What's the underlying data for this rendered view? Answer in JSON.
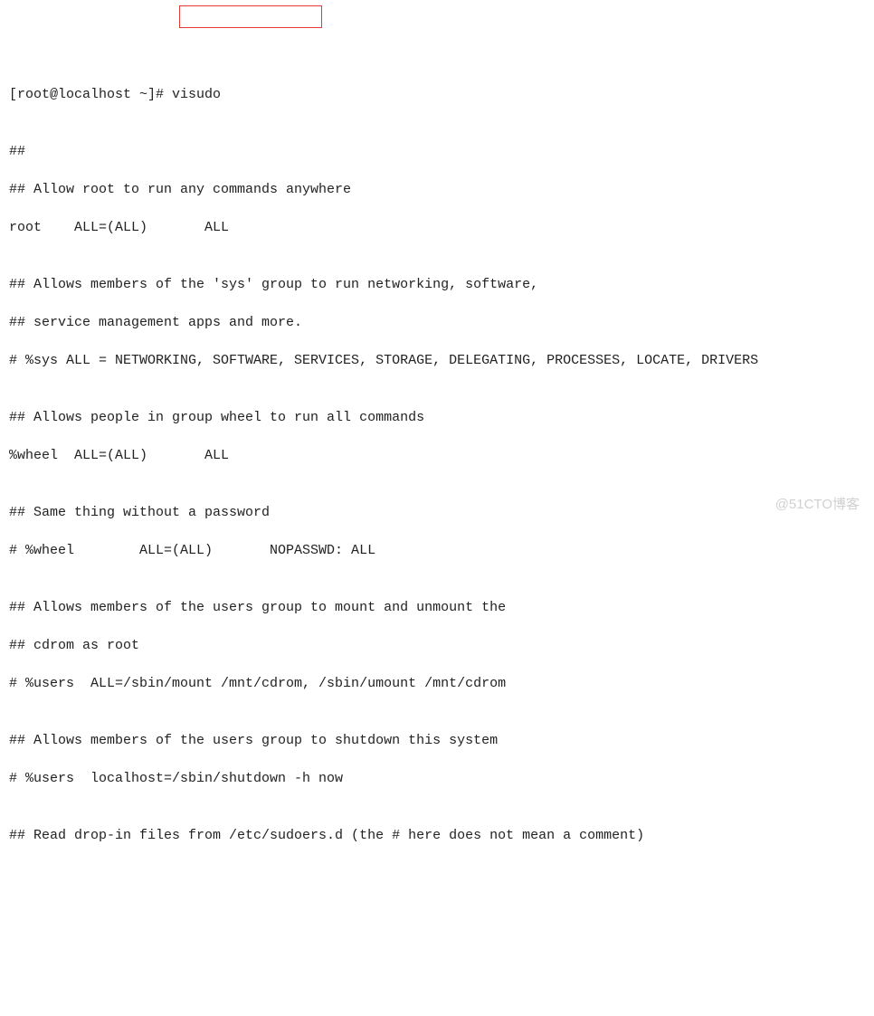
{
  "prompt": {
    "user_host": "[root@localhost ~]# ",
    "command": "visudo"
  },
  "lines": {
    "l0": "",
    "l1": "##",
    "l2": "## Allow root to run any commands anywhere",
    "l3": "root    ALL=(ALL)       ALL",
    "l4": "",
    "l5": "## Allows members of the 'sys' group to run networking, software,",
    "l6": "## service management apps and more.",
    "l7": "# %sys ALL = NETWORKING, SOFTWARE, SERVICES, STORAGE, DELEGATING, PROCESSES, LOCATE, DRIVERS",
    "l8": "",
    "l9": "## Allows people in group wheel to run all commands",
    "l10": "%wheel  ALL=(ALL)       ALL",
    "l11": "",
    "l12": "## Same thing without a password",
    "l13": "# %wheel        ALL=(ALL)       NOPASSWD: ALL",
    "l14": "",
    "l15": "## Allows members of the users group to mount and unmount the",
    "l16": "## cdrom as root",
    "l17": "# %users  ALL=/sbin/mount /mnt/cdrom, /sbin/umount /mnt/cdrom",
    "l18": "",
    "l19": "## Allows members of the users group to shutdown this system",
    "l20": "# %users  localhost=/sbin/shutdown -h now",
    "l21": "",
    "l22": "## Read drop-in files from /etc/sudoers.d (the # here does not mean a comment)"
  },
  "watermark": "@51CTO博客"
}
